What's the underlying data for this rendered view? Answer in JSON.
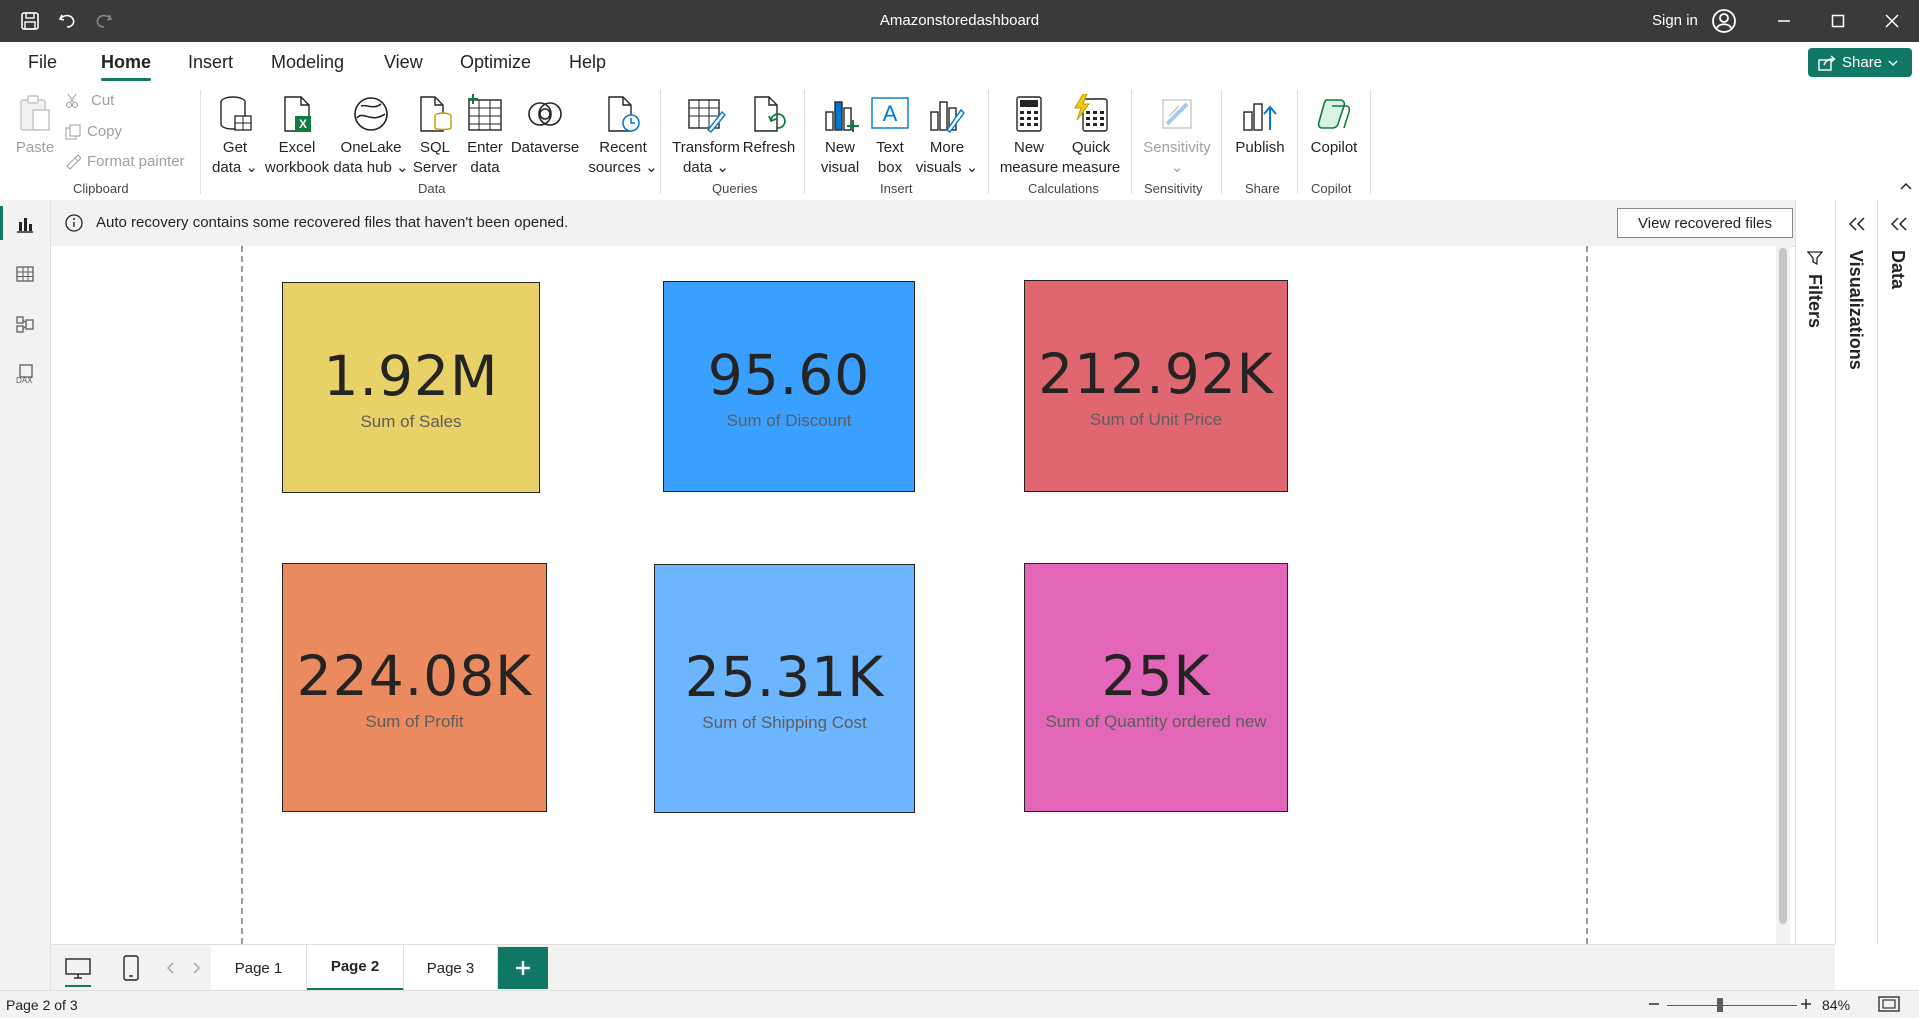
{
  "window": {
    "title": "Amazonstoredashboard",
    "sign_in": "Sign in"
  },
  "menu": {
    "tabs": [
      "File",
      "Home",
      "Insert",
      "Modeling",
      "View",
      "Optimize",
      "Help"
    ],
    "active": "Home",
    "share": "Share"
  },
  "ribbon": {
    "clipboard": {
      "paste": "Paste",
      "cut": "Cut",
      "copy": "Copy",
      "format_painter": "Format painter",
      "label": "Clipboard"
    },
    "data": {
      "get_data": [
        "Get",
        "data"
      ],
      "excel": [
        "Excel",
        "workbook"
      ],
      "onelake": [
        "OneLake",
        "data hub"
      ],
      "sql": [
        "SQL",
        "Server"
      ],
      "enter": [
        "Enter",
        "data"
      ],
      "dataverse": "Dataverse",
      "recent": [
        "Recent",
        "sources"
      ],
      "label": "Data"
    },
    "queries": {
      "transform": [
        "Transform",
        "data"
      ],
      "refresh": "Refresh",
      "label": "Queries"
    },
    "insert": {
      "new_visual": [
        "New",
        "visual"
      ],
      "text_box": [
        "Text",
        "box"
      ],
      "more_visuals": [
        "More",
        "visuals"
      ],
      "label": "Insert"
    },
    "calculations": {
      "new_measure": [
        "New",
        "measure"
      ],
      "quick_measure": [
        "Quick",
        "measure"
      ],
      "label": "Calculations"
    },
    "sensitivity": {
      "button": "Sensitivity",
      "label": "Sensitivity"
    },
    "share": {
      "publish": "Publish",
      "label": "Share"
    },
    "copilot": {
      "button": "Copilot",
      "label": "Copilot"
    }
  },
  "infobar": {
    "message": "Auto recovery contains some recovered files that haven't been opened.",
    "button": "View recovered files"
  },
  "cards": [
    {
      "value": "1.92M",
      "label": "Sum of Sales",
      "color": "#E8D166"
    },
    {
      "value": "95.60",
      "label": "Sum of Discount",
      "color": "#3AA0FF"
    },
    {
      "value": "212.92K",
      "label": "Sum of Unit Price",
      "color": "#E06670"
    },
    {
      "value": "224.08K",
      "label": "Sum of Profit",
      "color": "#EA8A5E"
    },
    {
      "value": "25.31K",
      "label": "Sum of Shipping Cost",
      "color": "#6CB6FF"
    },
    {
      "value": "25K",
      "label": "Sum of Quantity ordered new",
      "color": "#E466B9"
    }
  ],
  "panes": {
    "filters": "Filters",
    "visualizations": "Visualizations",
    "data": "Data"
  },
  "pages": {
    "tabs": [
      "Page 1",
      "Page 2",
      "Page 3"
    ],
    "active": "Page 2"
  },
  "status": {
    "page_info": "Page 2 of 3",
    "zoom": "84%",
    "zoom_level_percent": 84
  },
  "theme": {
    "accent": "#117865",
    "titlebar": "#3B3A39"
  }
}
